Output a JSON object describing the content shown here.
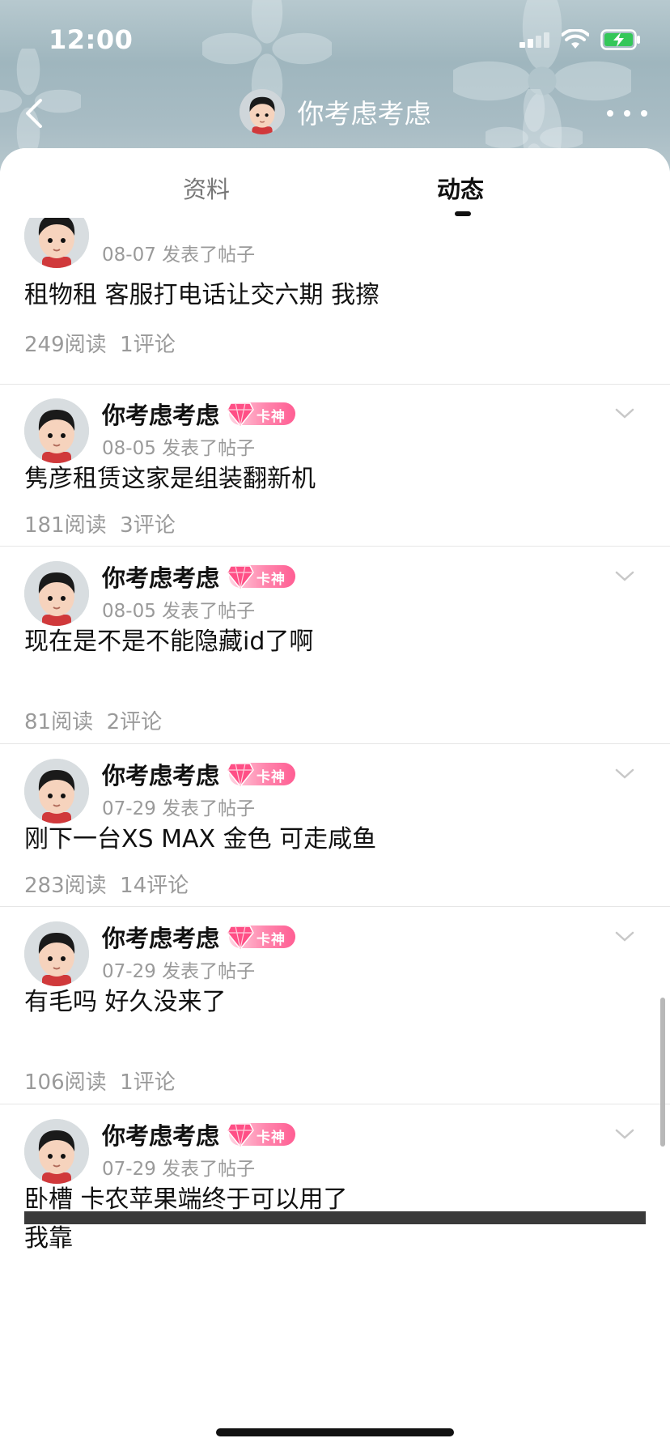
{
  "status_bar": {
    "time": "12:00"
  },
  "nav": {
    "title": "你考虑考虑"
  },
  "tabs": [
    {
      "label": "资料",
      "active": false
    },
    {
      "label": "动态",
      "active": true
    }
  ],
  "badge_label": "卡神",
  "posts": [
    {
      "username": "",
      "date_action": "08-07 发表了帖子",
      "content": "租物租 客服打电话让交六期 我擦",
      "reads": "249阅读",
      "comments": "1评论"
    },
    {
      "username": "你考虑考虑",
      "date_action": "08-05 发表了帖子",
      "content": "隽彦租赁这家是组装翻新机",
      "reads": "181阅读",
      "comments": "3评论"
    },
    {
      "username": "你考虑考虑",
      "date_action": "08-05 发表了帖子",
      "content": "现在是不是不能隐藏id了啊",
      "reads": "81阅读",
      "comments": "2评论"
    },
    {
      "username": "你考虑考虑",
      "date_action": "07-29 发表了帖子",
      "content": "刚下一台XS MAX 金色 可走咸鱼",
      "reads": "283阅读",
      "comments": "14评论"
    },
    {
      "username": "你考虑考虑",
      "date_action": "07-29 发表了帖子",
      "content": "有毛吗 好久没来了",
      "reads": "106阅读",
      "comments": "1评论"
    },
    {
      "username": "你考虑考虑",
      "date_action": "07-29 发表了帖子",
      "content_line1": "卧槽 卡农苹果端终于可以用了",
      "content_line2": "我靠"
    }
  ],
  "colors": {
    "accent_badge": "#ff5e93",
    "text_primary": "#111111",
    "text_secondary": "#9a9a9a",
    "battery": "#34c759"
  }
}
